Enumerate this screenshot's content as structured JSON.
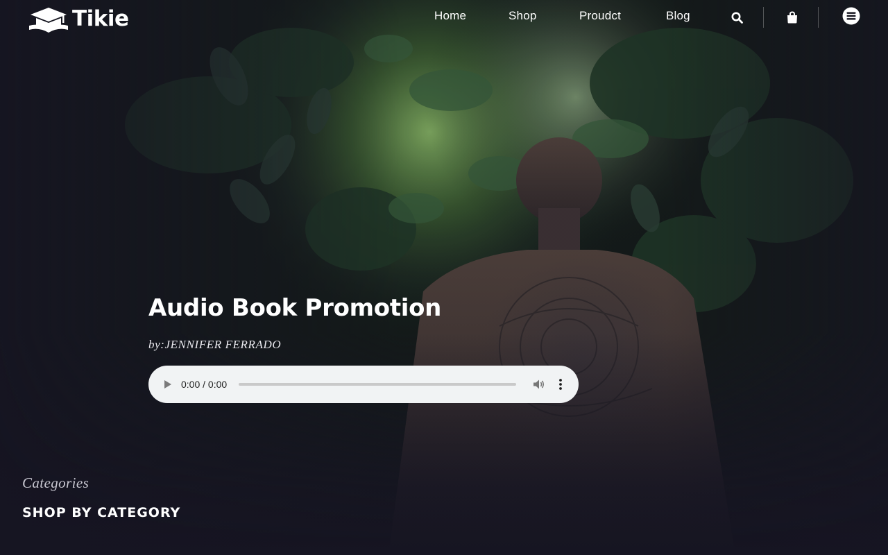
{
  "brand": {
    "name": "Tikie",
    "logo_icon": "book-cap-icon"
  },
  "nav": {
    "items": [
      {
        "label": "Home"
      },
      {
        "label": "Shop"
      },
      {
        "label": "Proudct"
      },
      {
        "label": "Blog"
      }
    ],
    "icons": [
      "search-icon",
      "shopping-bag-icon",
      "hamburger-menu-icon"
    ]
  },
  "hero": {
    "title": "Audio Book Promotion",
    "author": "by:JENNIFER FERRADO",
    "background": "forest-path-photo"
  },
  "audio_player": {
    "time_display": "0:00 / 0:00",
    "progress": 0,
    "icons": [
      "play-icon",
      "volume-icon",
      "more-options-icon"
    ]
  },
  "categories": {
    "eyebrow": "Categories",
    "heading": "SHOP BY CATEGORY"
  },
  "colors": {
    "page_background": "#15141f",
    "text_primary": "#ffffff",
    "player_background": "#f1f3f4"
  }
}
